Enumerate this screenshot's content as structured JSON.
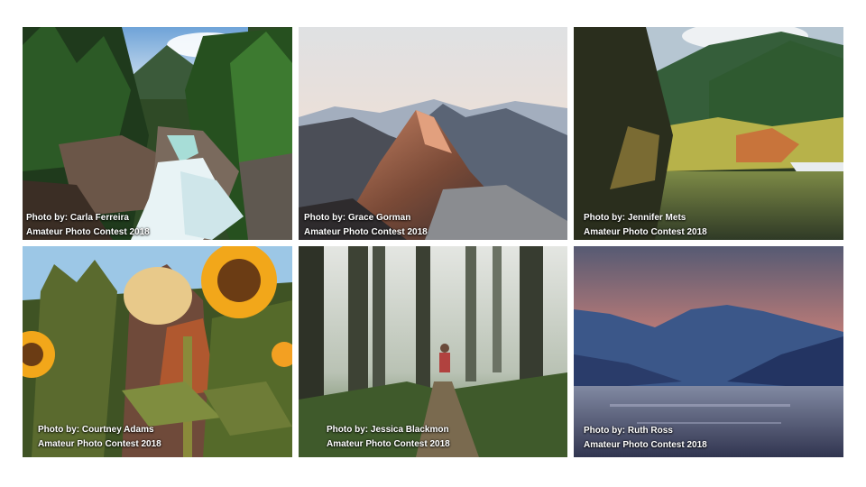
{
  "photos": [
    {
      "credit": "Photo by: Carla Ferreira",
      "contest": "Amateur Photo Contest 2018"
    },
    {
      "credit": "Photo by: Grace Gorman",
      "contest": "Amateur Photo Contest 2018"
    },
    {
      "credit": "Photo by: Jennifer Mets",
      "contest": "Amateur Photo Contest 2018"
    },
    {
      "credit": "Photo by: Courtney Adams",
      "contest": "Amateur Photo Contest 2018"
    },
    {
      "credit": "Photo by: Jessica Blackmon",
      "contest": "Amateur Photo Contest 2018"
    },
    {
      "credit": "Photo by: Ruth Ross",
      "contest": "Amateur Photo Contest 2018"
    }
  ]
}
